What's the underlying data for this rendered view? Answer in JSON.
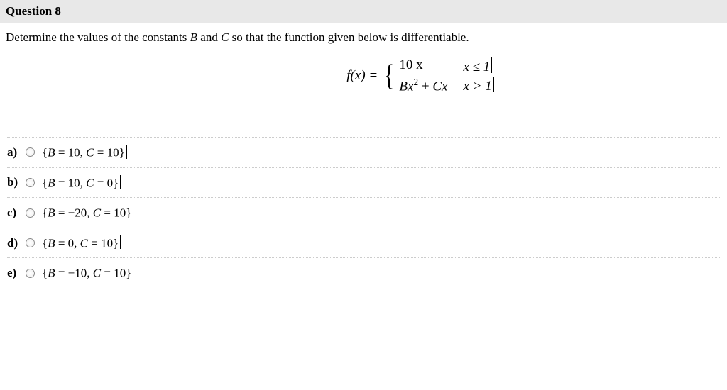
{
  "header": {
    "title": "Question 8"
  },
  "prompt": {
    "text_before_B": "Determine the values of the constants ",
    "B": "B",
    "text_and": " and ",
    "C": "C",
    "text_after": " so that the function given below is differentiable."
  },
  "formula": {
    "lhs": "f(x) =",
    "case1_expr": "10 x",
    "case1_cond": "x ≤ 1",
    "case2_expr_B": "B",
    "case2_expr_x2": "x",
    "case2_expr_sup": "2",
    "case2_expr_plus": " + ",
    "case2_expr_C": "C",
    "case2_expr_x": "x",
    "case2_cond": "x > 1"
  },
  "options": [
    {
      "label": "a)",
      "B": "B",
      "C": "C",
      "Bval": "10",
      "Cval": "10",
      "Bsign": "= ",
      "Csign": "= "
    },
    {
      "label": "b)",
      "B": "B",
      "C": "C",
      "Bval": "10",
      "Cval": "0",
      "Bsign": "= ",
      "Csign": "= "
    },
    {
      "label": "c)",
      "B": "B",
      "C": "C",
      "Bval": "20",
      "Cval": "10",
      "Bsign": "= −",
      "Csign": "= "
    },
    {
      "label": "d)",
      "B": "B",
      "C": "C",
      "Bval": "0",
      "Cval": "10",
      "Bsign": "= ",
      "Csign": "= "
    },
    {
      "label": "e)",
      "B": "B",
      "C": "C",
      "Bval": "10",
      "Cval": "10",
      "Bsign": "= −",
      "Csign": "= "
    }
  ]
}
